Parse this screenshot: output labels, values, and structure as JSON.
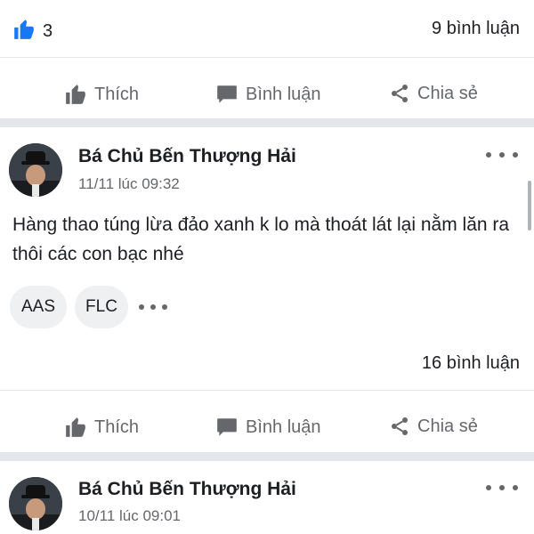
{
  "top_post": {
    "like_count": "3",
    "comment_count": "9 bình luận"
  },
  "actions": {
    "like": "Thích",
    "comment": "Bình luận",
    "share": "Chia sẻ"
  },
  "post1": {
    "author": "Bá Chủ Bến Thượng Hải",
    "timestamp": "11/11 lúc 09:32",
    "body": "Hàng thao túng lừa đảo xanh k lo mà thoát lát lại nằm lăn ra thôi các con bạc nhé",
    "tags": [
      "AAS",
      "FLC"
    ],
    "comment_count": "16 bình luận"
  },
  "post2": {
    "author": "Bá Chủ Bến Thượng Hải",
    "timestamp": "10/11 lúc 09:01"
  },
  "colors": {
    "accent": "#1877f2",
    "icon_grey": "#65676b",
    "separator": "#e4e6eb"
  }
}
